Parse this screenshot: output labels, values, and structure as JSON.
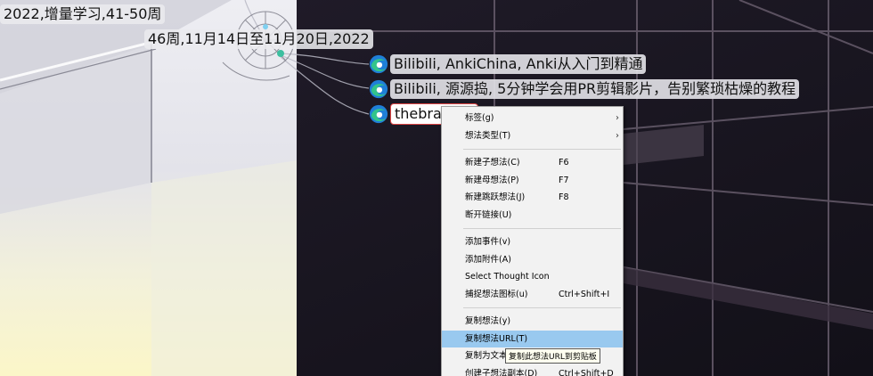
{
  "thoughts": {
    "parent": "2022,增量学习,41-50周",
    "week": "46周,11月14日至11月20日,2022",
    "items": [
      {
        "label": "Bilibili, AnkiChina, Anki从入门到精通",
        "icon": "edge-browser-icon"
      },
      {
        "label": "Bilibili, 源源捣, 5分钟学会用PR剪辑影片，告别繁琐枯燥的教程",
        "icon": "edge-browser-icon"
      },
      {
        "label": "thebra",
        "icon": "edge-browser-icon"
      }
    ]
  },
  "context_menu": {
    "items": [
      {
        "label": "标签(g)",
        "shortcut": "",
        "submenu_arrow": "›"
      },
      {
        "label": "想法类型(T)",
        "shortcut": "",
        "submenu_arrow": "›"
      },
      {
        "label": "新建子想法(C)",
        "shortcut": "F6"
      },
      {
        "label": "新建母想法(P)",
        "shortcut": "F7"
      },
      {
        "label": "新建跳跃想法(J)",
        "shortcut": "F8"
      },
      {
        "label": "断开链接(U)",
        "shortcut": ""
      },
      {
        "label": "添加事件(v)",
        "shortcut": ""
      },
      {
        "label": "添加附件(A)",
        "shortcut": ""
      },
      {
        "label": "Select Thought Icon",
        "shortcut": ""
      },
      {
        "label": "捕捉想法图标(u)",
        "shortcut": "Ctrl+Shift+I"
      },
      {
        "label": "复制想法(y)",
        "shortcut": ""
      },
      {
        "label": "复制想法URL(T)",
        "shortcut": "",
        "highlighted": true
      },
      {
        "label": "复制为文本(x)",
        "shortcut": ""
      },
      {
        "label": "创建子想法副本(D)",
        "shortcut": "Ctrl+Shift+D"
      }
    ]
  },
  "tooltip": {
    "text": "复制此想法URL到剪贴板"
  },
  "colors": {
    "menu_highlight": "#99c9ef",
    "selection_border": "#dd4444",
    "edge_blue": "#1f7fd8",
    "edge_green": "#33c48a"
  }
}
